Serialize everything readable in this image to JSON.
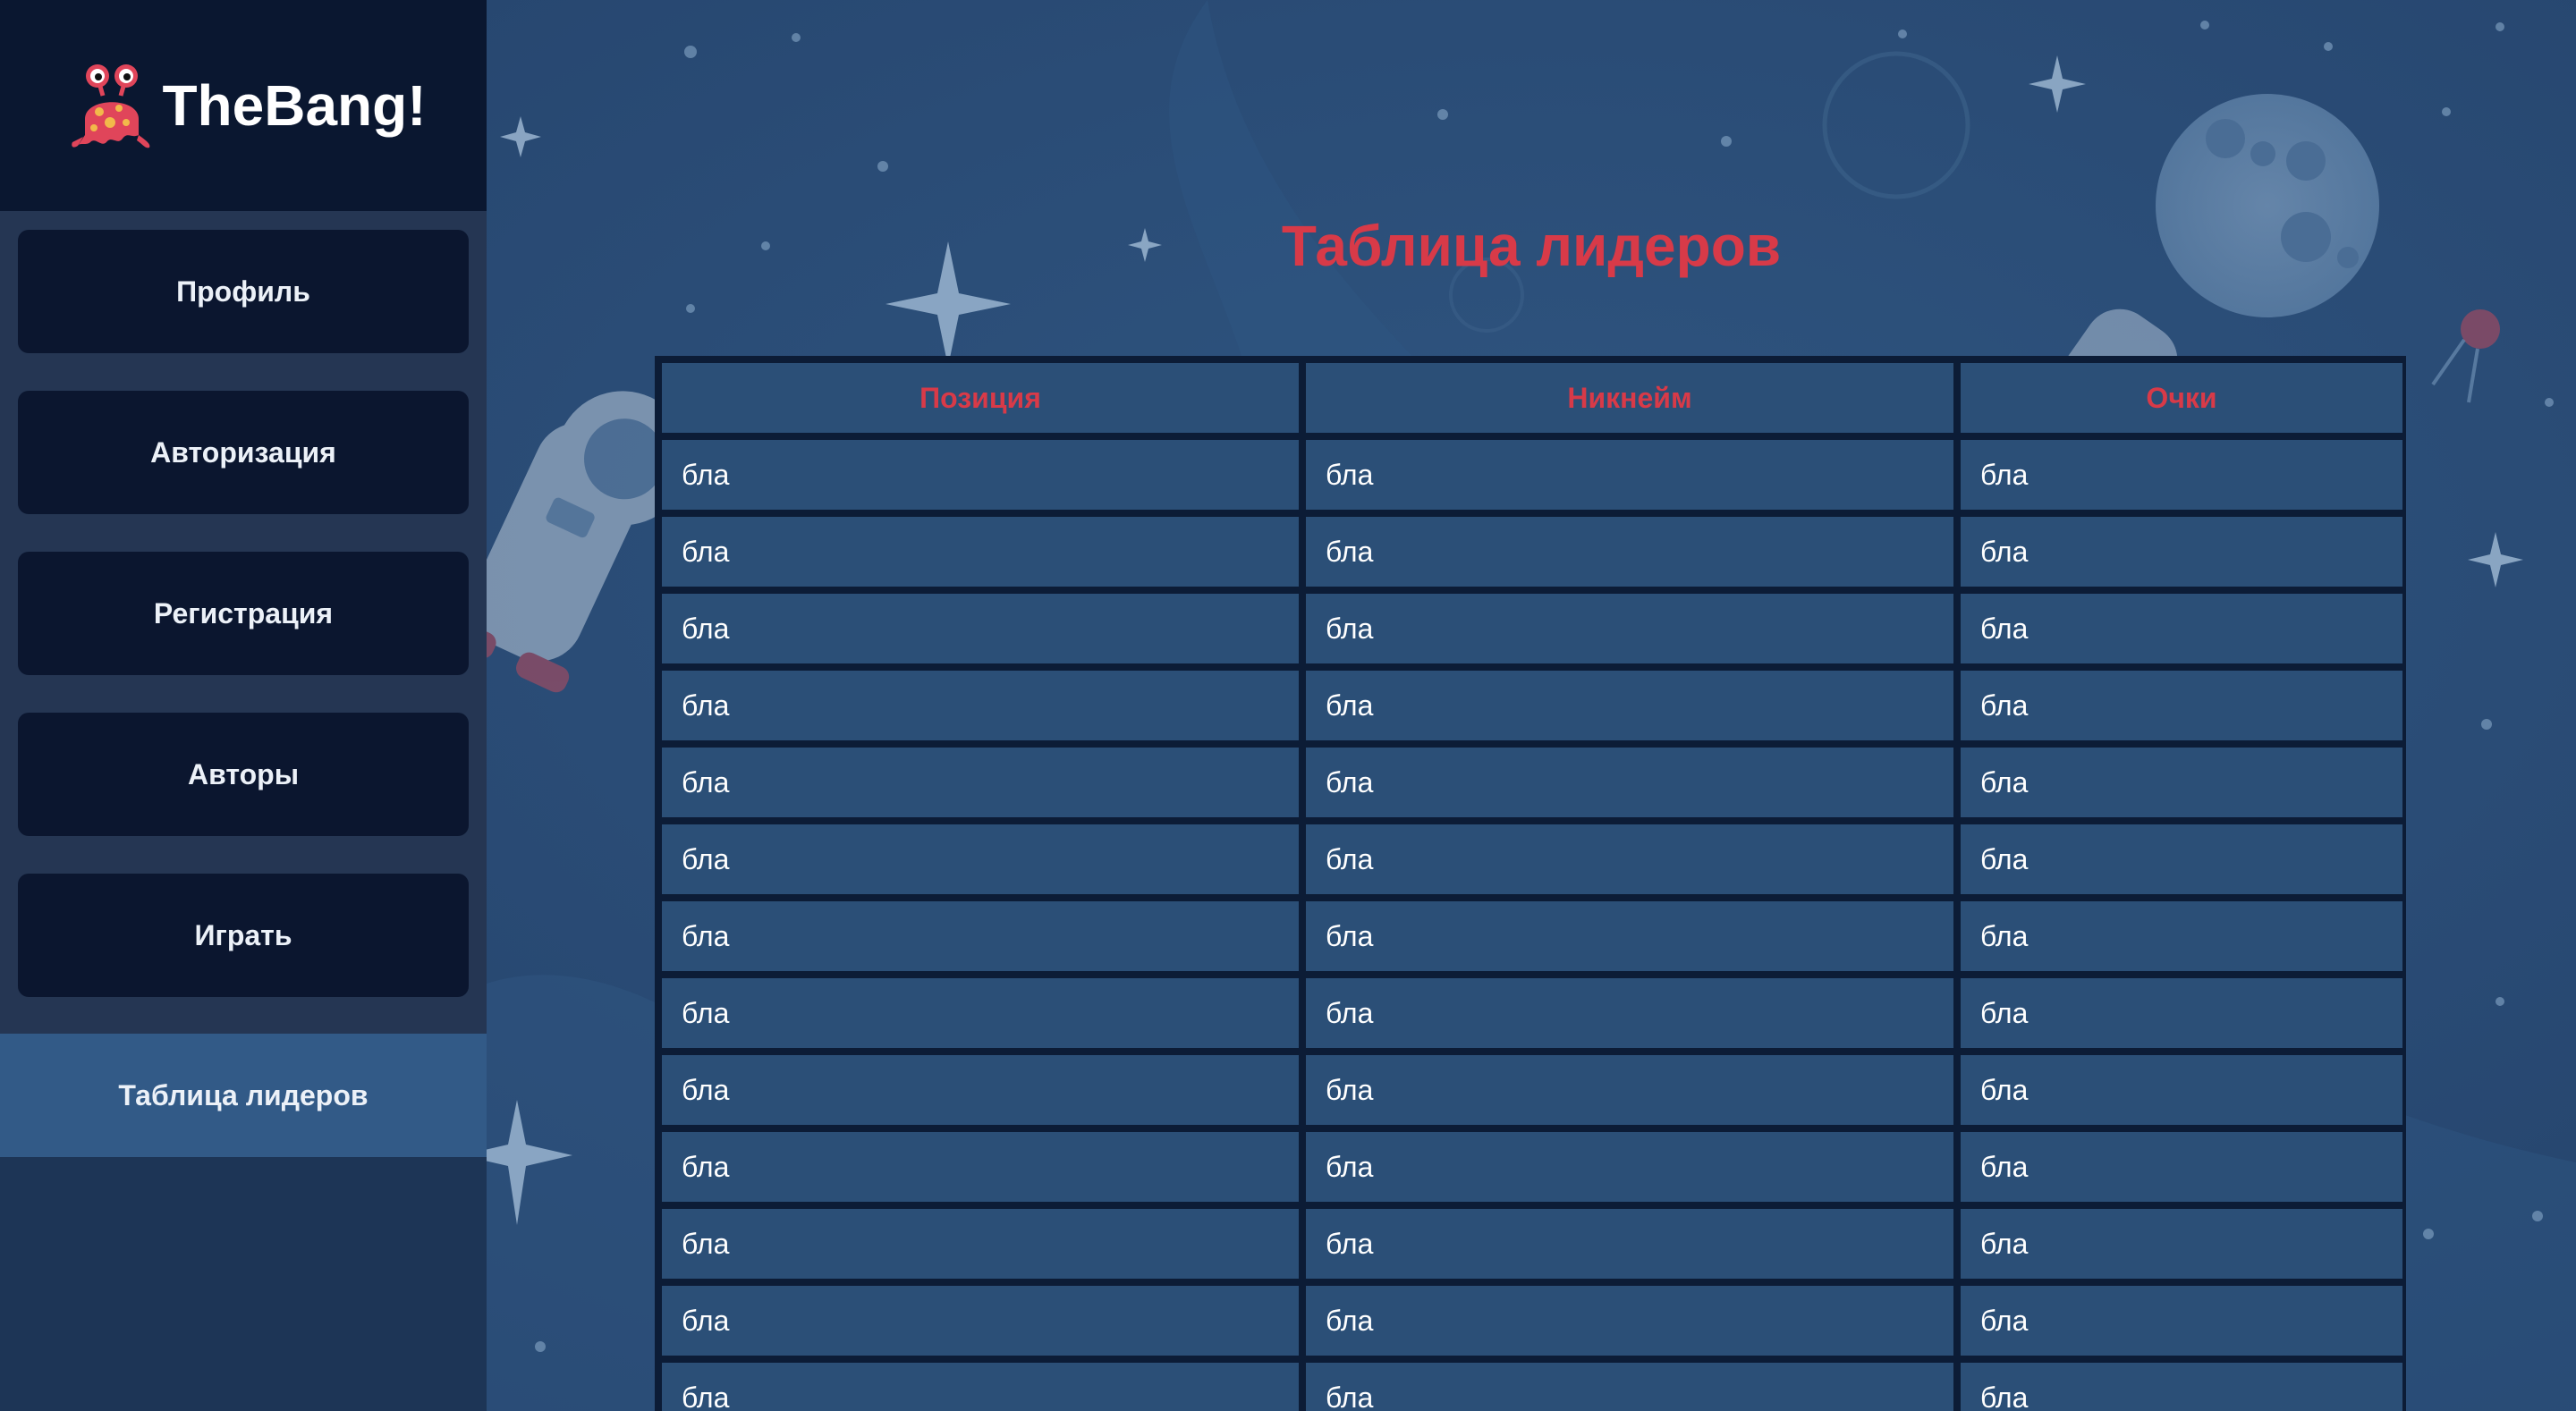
{
  "app": {
    "name": "TheBang!"
  },
  "sidebar": {
    "items": [
      {
        "label": "Профиль"
      },
      {
        "label": "Авторизация"
      },
      {
        "label": "Регистрация"
      },
      {
        "label": "Авторы"
      },
      {
        "label": "Играть"
      },
      {
        "label": "Таблица лидеров",
        "active": true
      }
    ]
  },
  "main": {
    "title": "Таблица лидеров",
    "table": {
      "headers": [
        "Позиция",
        "Никнейм",
        "Очки"
      ],
      "rows": [
        [
          "бла",
          "бла",
          "бла"
        ],
        [
          "бла",
          "бла",
          "бла"
        ],
        [
          "бла",
          "бла",
          "бла"
        ],
        [
          "бла",
          "бла",
          "бла"
        ],
        [
          "бла",
          "бла",
          "бла"
        ],
        [
          "бла",
          "бла",
          "бла"
        ],
        [
          "бла",
          "бла",
          "бла"
        ],
        [
          "бла",
          "бла",
          "бла"
        ],
        [
          "бла",
          "бла",
          "бла"
        ],
        [
          "бла",
          "бла",
          "бла"
        ],
        [
          "бла",
          "бла",
          "бла"
        ],
        [
          "бла",
          "бла",
          "бла"
        ],
        [
          "бла",
          "бла",
          "бла"
        ]
      ]
    }
  },
  "theme": {
    "accent": "#d83a48",
    "nav_button_bg": "#09142c",
    "nav_active_bg": "#325a87",
    "logo_bar_bg": "#0a1730",
    "page_bg": "#2a4c76"
  },
  "icons": {
    "logo": "alien-monster-icon"
  }
}
